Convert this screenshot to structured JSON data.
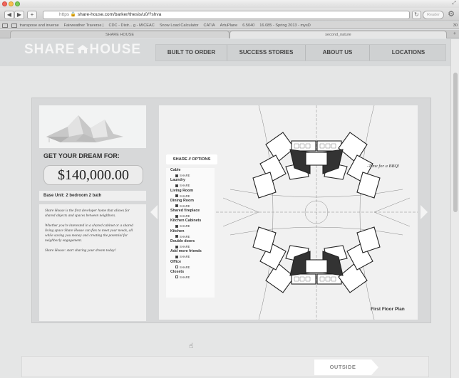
{
  "browser": {
    "url_proto": "https",
    "url": "share-house.com/barker/thesis/u0/?shva",
    "reader": "Reader",
    "bookmarks": [
      "transpose and inverse",
      "Fairweather Traverse |",
      "CDC - Distr... g - MICEAC",
      "Snow Load Calculator",
      "CATIA",
      "ArtuPlane",
      "6.5040",
      "16.085 - Spring 2013 - mysD"
    ],
    "bookmark_tail": "30",
    "tabs": [
      "SHARE HOUSE",
      "second_nature"
    ]
  },
  "site": {
    "logo_left": "SHARE",
    "logo_right": "HOUSE",
    "nav": [
      "BUILT TO ORDER",
      "SUCCESS STORIES",
      "ABOUT US",
      "LOCATIONS"
    ]
  },
  "left_panel": {
    "dream_label": "GET YOUR DREAM FOR:",
    "price": "$140,000.00",
    "base_unit": "Base Unit: 2 bedroom 2 bath",
    "desc": [
      "Share House is the first developer home that allows for shared objects and spaces between neighbors.",
      "Whether you're interested in a shared cabinet or a shared living space Share House can flex to meet your needs, all while saving you money and creating the potential for neighborly engagement.",
      "Share House: start sharing your dream today!"
    ]
  },
  "options": {
    "title": "SHARE // OPTIONS",
    "share_label": "SHARE",
    "items": [
      {
        "name": "Cable",
        "checked": true
      },
      {
        "name": "Laundry",
        "checked": true
      },
      {
        "name": "Living Room",
        "checked": true
      },
      {
        "name": "Dining Room",
        "checked": true
      },
      {
        "name": "Shared fireplace",
        "checked": true
      },
      {
        "name": "Kitchen Cabinets",
        "checked": true
      },
      {
        "name": "Kitchen",
        "checked": true
      },
      {
        "name": "Double doors",
        "checked": true
      },
      {
        "name": "Add more friends",
        "checked": true
      },
      {
        "name": "Office",
        "checked": false
      },
      {
        "name": "Closets",
        "checked": false
      }
    ]
  },
  "plan": {
    "bbq_note": "-Time for a BBQ!",
    "floor_label": "First Floor Plan"
  },
  "bottom": {
    "outside": "OUTSIDE"
  }
}
